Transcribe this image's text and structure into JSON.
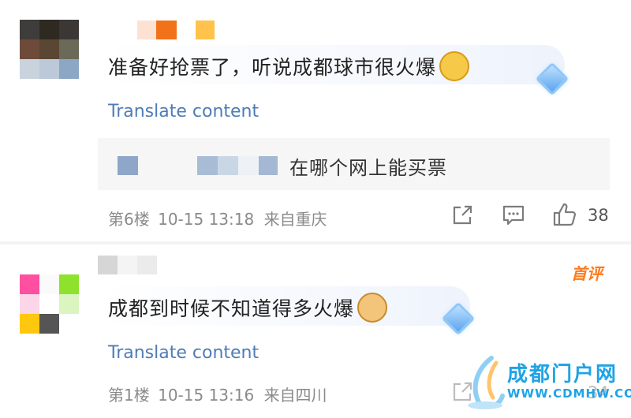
{
  "comments": [
    {
      "text": "准备好抢票了，听说成都球市很火爆",
      "emoji": "drooling-face-emoji",
      "translate": "Translate content",
      "reply": {
        "text": "在哪个网上能买票"
      },
      "floor": "第6楼",
      "time": "10-15 13:18",
      "location": "来自重庆",
      "likes": "38"
    },
    {
      "badge": "首评",
      "text": "成都到时候不知道得多火爆",
      "emoji": "doge-emoji",
      "translate": "Translate content",
      "floor": "第1楼",
      "time": "10-15 13:16",
      "location": "来自四川",
      "likes": "34"
    }
  ],
  "watermark": {
    "title": "成都门户网",
    "url": "WWW.CDMHW.COM"
  },
  "colors": {
    "link": "#4f7cb5",
    "badge": "#ff7a1a",
    "watermark": "#1fa3e6"
  }
}
